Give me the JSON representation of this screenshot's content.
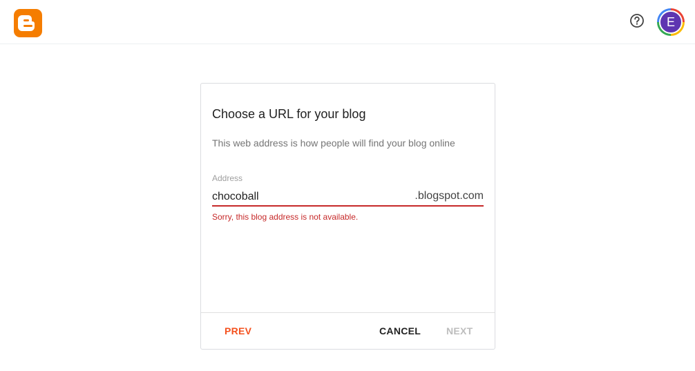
{
  "header": {
    "logo_icon": "blogger-logo-icon",
    "help_icon": "help-icon",
    "avatar_initial": "E"
  },
  "dialog": {
    "title": "Choose a URL for your blog",
    "subtitle": "This web address is how people will find your blog online",
    "address_label": "Address",
    "address_value": "chocoball",
    "domain_suffix": ".blogspot.com",
    "error_message": "Sorry, this blog address is not available.",
    "buttons": {
      "prev": "PREV",
      "cancel": "CANCEL",
      "next": "NEXT"
    }
  },
  "colors": {
    "brand": "#f57d00",
    "error": "#c62828",
    "accent": "#f4511e",
    "avatar_bg": "#5e35b1"
  }
}
